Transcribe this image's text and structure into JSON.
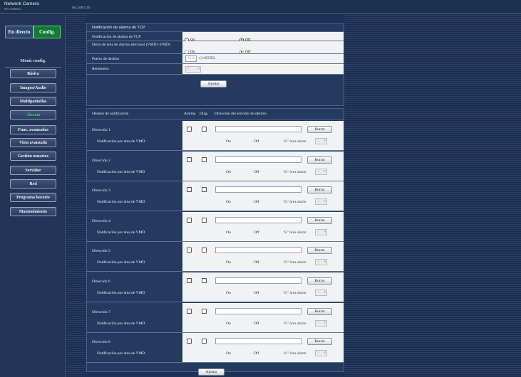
{
  "header": {
    "brand": "Network Camera",
    "model": "WV-S3531L",
    "ip": "192.168.0.10"
  },
  "sidebar": {
    "live_label": "En directo",
    "config_label": "Config.",
    "menu_title": "Menú config.",
    "items": [
      {
        "label": "Básica",
        "active": false
      },
      {
        "label": "Imagen/Audio",
        "active": false
      },
      {
        "label": "Multipantallas",
        "active": false
      },
      {
        "label": "Alarma",
        "active": true
      },
      {
        "label": "Func. avanzadas",
        "active": false
      },
      {
        "label": "Vista avanzada",
        "active": false
      },
      {
        "label": "Gestión usuarios",
        "active": false
      },
      {
        "label": "Servidor",
        "active": false
      },
      {
        "label": "Red",
        "active": false
      },
      {
        "label": "Programa horario",
        "active": false
      },
      {
        "label": "Mantenimiento",
        "active": false
      }
    ]
  },
  "tcp": {
    "section_title": "Notificación de alarma de TCP",
    "notif_label": "Notificación de alarma de TCP",
    "notif_on": "On",
    "notif_off": "Off",
    "vmd_label": "Datos de área de alarma adicional (VMD1-VMD)",
    "vmd_on": "On",
    "vmd_off": "Off",
    "port_label": "Puerto de destino",
    "port_value": "1818",
    "port_range": "(1-65535)",
    "retry_label": "Reintentos",
    "retry_value": "2",
    "set_button": "Ajustar"
  },
  "dest": {
    "col_dest": "Destino de notificación",
    "col_alarm": "Alarma",
    "col_diag": "Diag.",
    "col_server": "Dirección del servidor de destino",
    "vmd_label": "Notificación por área de VMD",
    "on": "On",
    "off": "Off",
    "area_label": "N.º área alarm",
    "area_value": "1",
    "delete_label": "Borrar",
    "rows": [
      {
        "label": "Dirección 1"
      },
      {
        "label": "Dirección 2"
      },
      {
        "label": "Dirección 3"
      },
      {
        "label": "Dirección 4"
      },
      {
        "label": "Dirección 5"
      },
      {
        "label": "Dirección 6"
      },
      {
        "label": "Dirección 7"
      },
      {
        "label": "Dirección 8"
      }
    ],
    "set_button": "Ajustar"
  }
}
